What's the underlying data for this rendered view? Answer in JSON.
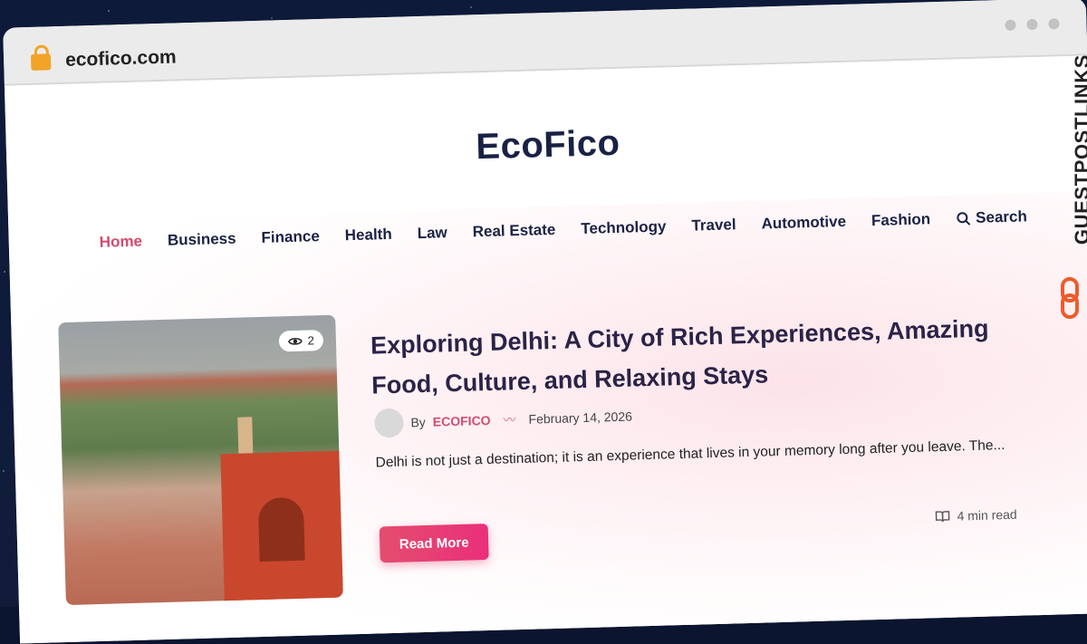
{
  "browser": {
    "url": "ecofico.com"
  },
  "site": {
    "brand": "EcoFico",
    "nav": [
      {
        "label": "Home",
        "active": true
      },
      {
        "label": "Business"
      },
      {
        "label": "Finance"
      },
      {
        "label": "Health"
      },
      {
        "label": "Law"
      },
      {
        "label": "Real Estate"
      },
      {
        "label": "Technology"
      },
      {
        "label": "Travel"
      },
      {
        "label": "Automotive"
      },
      {
        "label": "Fashion"
      }
    ],
    "search_label": "Search"
  },
  "post": {
    "views": "2",
    "title": "Exploring Delhi: A City of Rich Experiences, Amazing Food, Culture, and Relaxing Stays",
    "by": "By",
    "author": "ECOFICO",
    "date": "February 14, 2026",
    "excerpt": "Delhi is not just a destination; it is an experience that lives in your memory long after you leave. The...",
    "button": "Read More",
    "read_time": "4 min read"
  },
  "sidebar_brand": "GUESTPOSTLINKS",
  "colors": {
    "accent": "#d54a6f",
    "title": "#1a2244",
    "button_from": "#e44d6e",
    "button_to": "#ea2f7b"
  }
}
